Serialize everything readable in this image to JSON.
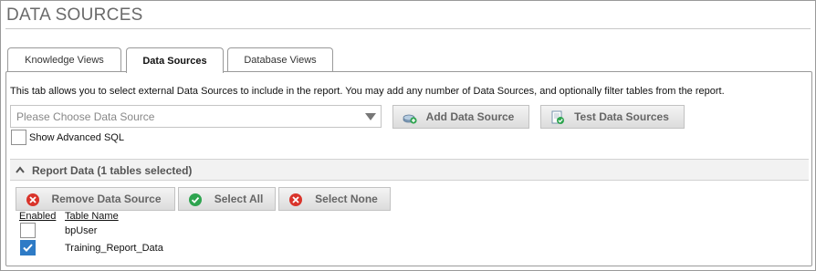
{
  "page": {
    "title": "DATA SOURCES"
  },
  "tabs": [
    {
      "label": "Knowledge Views",
      "active": false
    },
    {
      "label": "Data Sources",
      "active": true
    },
    {
      "label": "Database Views",
      "active": false
    }
  ],
  "description": "This tab allows you to select external Data Sources to include in the report. You may add any number of Data Sources, and optionally filter tables from the report.",
  "data_source_select": {
    "placeholder": "Please Choose Data Source"
  },
  "toolbar": {
    "add_label": "Add Data Source",
    "test_label": "Test Data Sources"
  },
  "advanced_sql": {
    "label": "Show Advanced SQL",
    "checked": false
  },
  "report_section": {
    "title": "Report Data (1 tables selected)",
    "remove_label": "Remove Data Source",
    "select_all_label": "Select All",
    "select_none_label": "Select None",
    "columns": [
      "Enabled",
      "Table Name"
    ],
    "rows": [
      {
        "enabled": false,
        "table_name": "bpUser"
      },
      {
        "enabled": true,
        "table_name": "Training_Report_Data"
      }
    ]
  },
  "colors": {
    "accent_blue": "#2e7bc6",
    "icon_red": "#d9342b",
    "icon_green": "#2ea44f",
    "button_text": "#666666"
  },
  "icons": [
    "add-data-source-icon",
    "test-data-sources-icon",
    "caret-up-icon",
    "remove-icon",
    "select-all-check-icon",
    "select-none-icon",
    "checkmark-icon",
    "dropdown-arrow-icon"
  ]
}
